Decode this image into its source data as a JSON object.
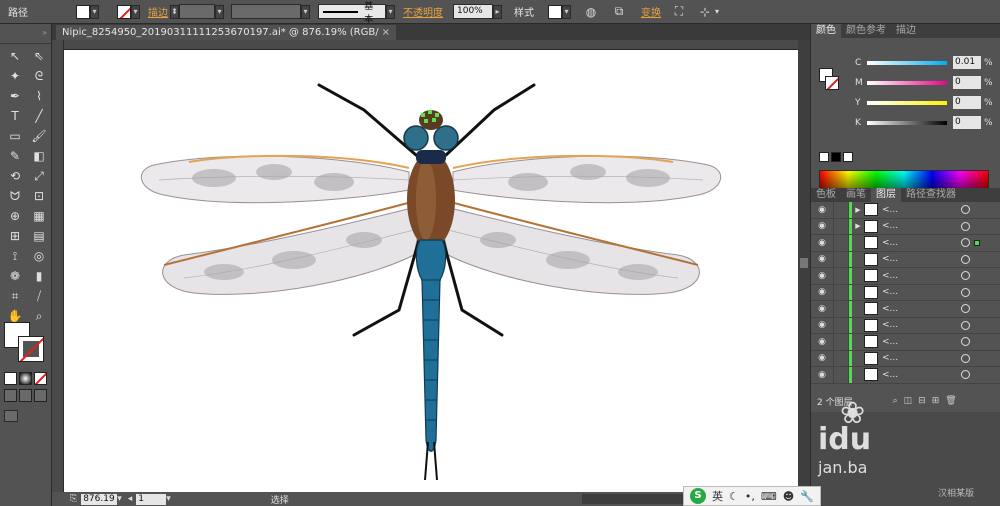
{
  "control_bar": {
    "selection_label": "路径",
    "stroke_label": "描边",
    "stroke_style": "基本",
    "opacity_label": "不透明度",
    "opacity_value": "100%",
    "style_label": "样式",
    "transform_label": "变换"
  },
  "document": {
    "tab_title": "Nipic_8254950_20190311111253670197.ai* @ 876.19% (RGB/预览)",
    "close_glyph": "×"
  },
  "status_bar": {
    "zoom": "876.19",
    "page": "1",
    "mode": "选择"
  },
  "color_panel": {
    "tabs": [
      "颜色",
      "颜色参考",
      "描边"
    ],
    "channels": [
      {
        "name": "C",
        "value": "0.01",
        "unit": "%"
      },
      {
        "name": "M",
        "value": "0",
        "unit": "%"
      },
      {
        "name": "Y",
        "value": "0",
        "unit": "%"
      },
      {
        "name": "K",
        "value": "0",
        "unit": "%"
      }
    ]
  },
  "layers_panel": {
    "tabs": [
      "色板",
      "画笔",
      "图层",
      "路径查找器"
    ],
    "item_label": "<...",
    "row_count": 11,
    "footer": "2 个图层"
  },
  "ime": {
    "logo": "S",
    "lang": "英"
  },
  "watermark": {
    "brand": "idu",
    "subtitle": "jan.ba",
    "credit": "汉相某版"
  },
  "colors": {
    "dragonfly_body": "#1f6f98",
    "dragonfly_thorax": "#7a4a28",
    "wing_fill": "#e8e6e8",
    "wing_edge": "#b3733a",
    "accent_orange": "#e8a33c",
    "layer_green": "#4fdc4f"
  }
}
